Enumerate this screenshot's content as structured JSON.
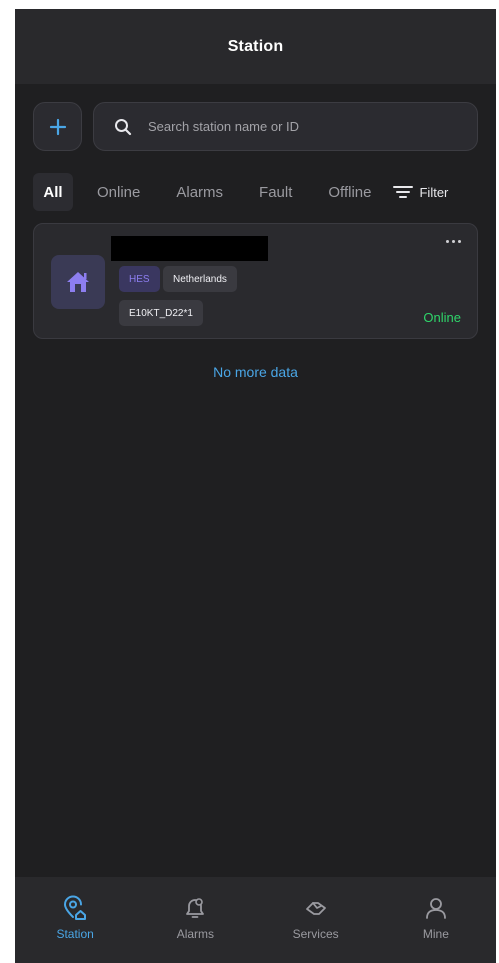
{
  "header": {
    "title": "Station"
  },
  "search": {
    "placeholder": "Search station name or ID"
  },
  "tabs": [
    {
      "label": "All",
      "active": true
    },
    {
      "label": "Online",
      "active": false
    },
    {
      "label": "Alarms",
      "active": false
    },
    {
      "label": "Fault",
      "active": false
    },
    {
      "label": "Offline",
      "active": false
    }
  ],
  "filter": {
    "label": "Filter",
    "icon": "filter-lines-icon"
  },
  "stations": [
    {
      "name": "",
      "name_redacted": true,
      "icon": "house-icon",
      "type_tag": "HES",
      "country_tag": "Netherlands",
      "device_tag": "E10KT_D22*1",
      "status": "Online",
      "status_color": "#2fd56a"
    }
  ],
  "list_footer": "No more data",
  "bottom_nav": [
    {
      "label": "Station",
      "icon": "station-pin-icon",
      "active": true
    },
    {
      "label": "Alarms",
      "icon": "bell-icon",
      "active": false
    },
    {
      "label": "Services",
      "icon": "handshake-icon",
      "active": false
    },
    {
      "label": "Mine",
      "icon": "person-icon",
      "active": false
    }
  ],
  "colors": {
    "accent": "#4aa6e6",
    "background": "#1f1f21",
    "online": "#2fd56a",
    "hes_tag": "#8d7ef0"
  }
}
